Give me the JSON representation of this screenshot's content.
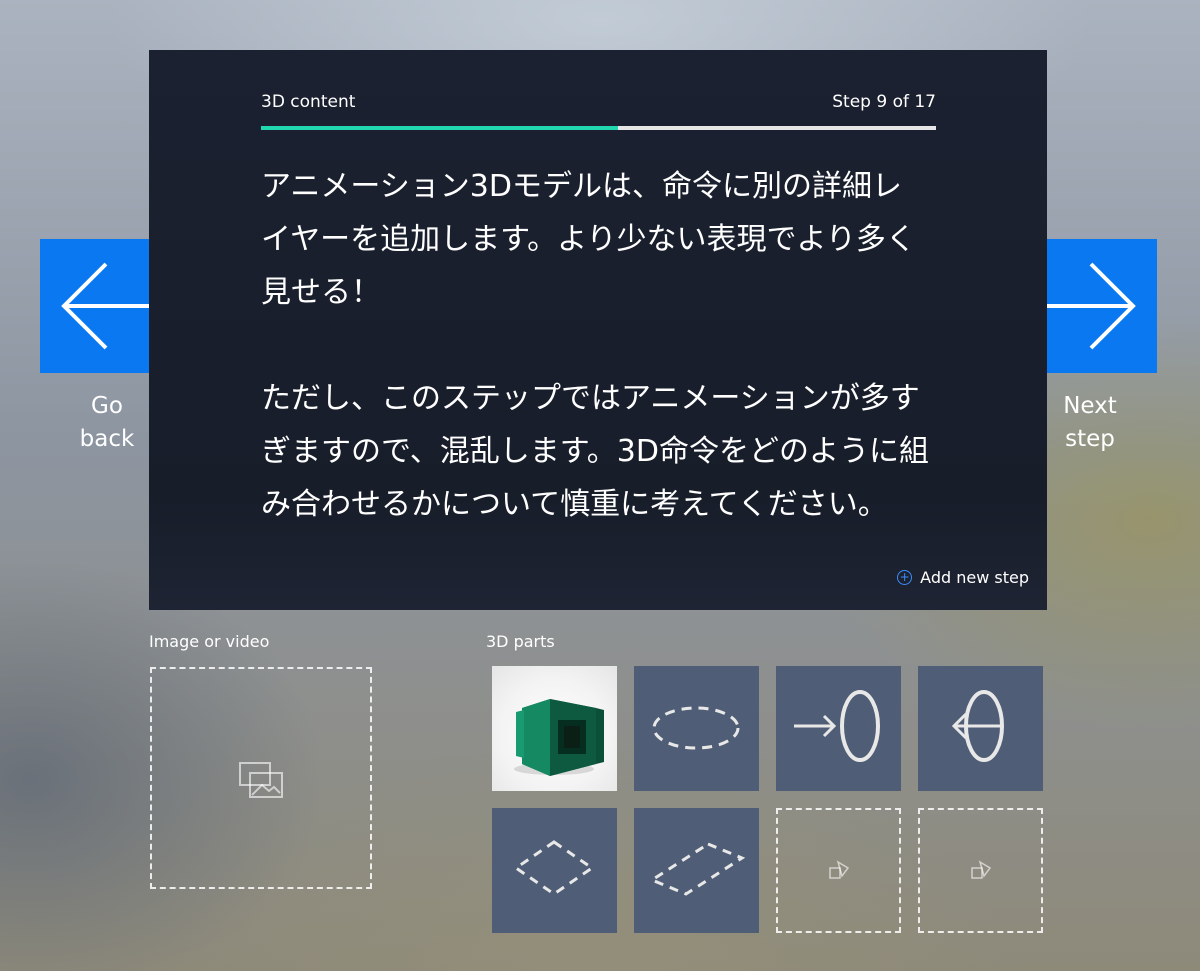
{
  "card": {
    "title": "3D content",
    "step": "Step 9 of 17",
    "progress_fraction": 0.529,
    "body": "アニメーション3Dモデルは、命令に別の詳細レイヤーを追加します。より少ない表現でより多く見せる！\n\nただし、このステップではアニメーションが多すぎますので、混乱します。3D命令をどのように組み合わせるかについて慎重に考えてください。",
    "add_step_label": "Add new step",
    "add_step_icon": "plus-circle-icon"
  },
  "nav": {
    "back_label": "Go\nback",
    "back_icon": "arrow-left-icon",
    "next_label": "Next\nstep",
    "next_icon": "arrow-right-icon"
  },
  "media": {
    "label": "Image or video",
    "icon": "image-gallery-icon"
  },
  "parts": {
    "label": "3D parts",
    "tiles": [
      {
        "kind": "model",
        "icon": "green-3d-model-thumbnail"
      },
      {
        "kind": "filled",
        "icon": "dashed-ring-icon"
      },
      {
        "kind": "filled",
        "icon": "arrow-to-ring-icon"
      },
      {
        "kind": "filled",
        "icon": "arrow-through-ring-icon"
      },
      {
        "kind": "filled",
        "icon": "dashed-square-frame-icon"
      },
      {
        "kind": "filled",
        "icon": "dashed-rectangle-frame-icon"
      },
      {
        "kind": "empty",
        "icon": "3d-shapes-icon"
      },
      {
        "kind": "empty",
        "icon": "3d-shapes-icon"
      }
    ]
  },
  "colors": {
    "accent_blue": "#0a78f0",
    "progress_teal": "#22d6b0",
    "card_bg": "#1b2130",
    "tile_bg": "#4f5e76"
  }
}
